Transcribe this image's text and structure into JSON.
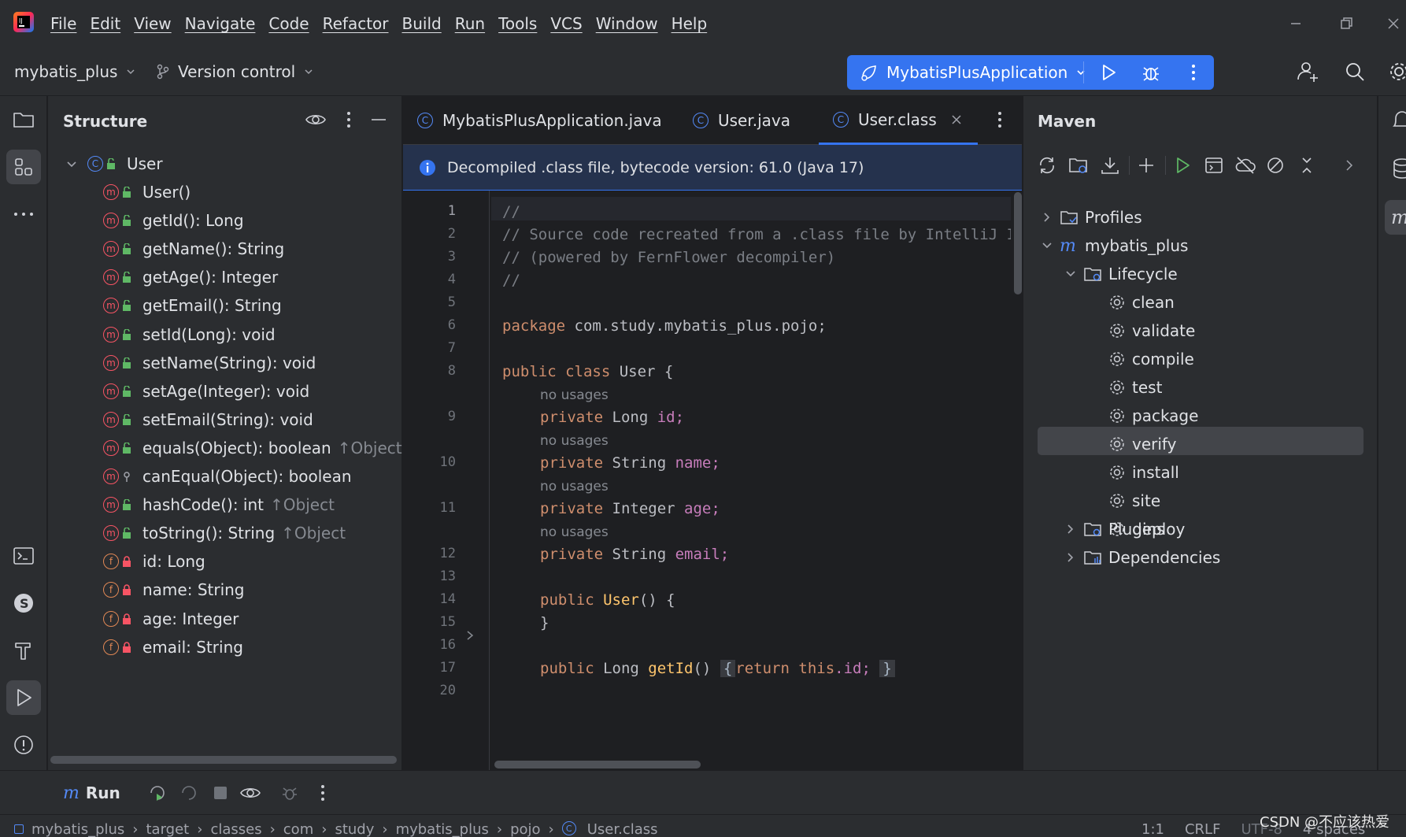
{
  "menu": [
    "File",
    "Edit",
    "View",
    "Navigate",
    "Code",
    "Refactor",
    "Build",
    "Run",
    "Tools",
    "VCS",
    "Window",
    "Help"
  ],
  "toolbar": {
    "project": "mybatis_plus",
    "vcs": "Version control",
    "run_config": "MybatisPlusApplication"
  },
  "structure": {
    "title": "Structure",
    "root": "User",
    "items": [
      {
        "kind": "m",
        "vis": "public",
        "label": "User()",
        "inherit": ""
      },
      {
        "kind": "m",
        "vis": "public",
        "label": "getId(): Long",
        "inherit": ""
      },
      {
        "kind": "m",
        "vis": "public",
        "label": "getName(): String",
        "inherit": ""
      },
      {
        "kind": "m",
        "vis": "public",
        "label": "getAge(): Integer",
        "inherit": ""
      },
      {
        "kind": "m",
        "vis": "public",
        "label": "getEmail(): String",
        "inherit": ""
      },
      {
        "kind": "m",
        "vis": "public",
        "label": "setId(Long): void",
        "inherit": ""
      },
      {
        "kind": "m",
        "vis": "public",
        "label": "setName(String): void",
        "inherit": ""
      },
      {
        "kind": "m",
        "vis": "public",
        "label": "setAge(Integer): void",
        "inherit": ""
      },
      {
        "kind": "m",
        "vis": "public",
        "label": "setEmail(String): void",
        "inherit": ""
      },
      {
        "kind": "m",
        "vis": "public",
        "label": "equals(Object): boolean",
        "inherit": "↑Object"
      },
      {
        "kind": "m",
        "vis": "protected",
        "label": "canEqual(Object): boolean",
        "inherit": ""
      },
      {
        "kind": "m",
        "vis": "public",
        "label": "hashCode(): int",
        "inherit": "↑Object"
      },
      {
        "kind": "m",
        "vis": "public",
        "label": "toString(): String",
        "inherit": "↑Object"
      },
      {
        "kind": "f",
        "vis": "private",
        "label": "id: Long",
        "inherit": ""
      },
      {
        "kind": "f",
        "vis": "private",
        "label": "name: String",
        "inherit": ""
      },
      {
        "kind": "f",
        "vis": "private",
        "label": "age: Integer",
        "inherit": ""
      },
      {
        "kind": "f",
        "vis": "private",
        "label": "email: String",
        "inherit": ""
      }
    ]
  },
  "editor": {
    "tabs": [
      "MybatisPlusApplication.java",
      "User.java",
      "User.class"
    ],
    "active_tab": 2,
    "banner": "Decompiled .class file, bytecode version: 61.0 (Java 17)",
    "line_numbers": [
      "1",
      "2",
      "3",
      "4",
      "5",
      "6",
      "7",
      "8",
      "9",
      "10",
      "11",
      "12",
      "13",
      "14",
      "15",
      "16",
      "17",
      "20"
    ],
    "comment1": "//",
    "comment2": "// Source code recreated from a .class file by IntelliJ IDEA",
    "comment3": "// (powered by FernFlower decompiler)",
    "comment4": "//",
    "kw_package": "package",
    "package_name": " com.study.mybatis_plus.pojo;",
    "kw_public_class": "public class",
    "class_name": " User {",
    "hint": "no usages",
    "kw_private": "private",
    "type_long": " Long ",
    "type_string": " String ",
    "type_integer": " Integer ",
    "field_id": "id;",
    "field_name": "name;",
    "field_age": "age;",
    "field_email": "email;",
    "kw_public": "public",
    "ctor_name": "User",
    "ctor_rest": "() {",
    "close_brace": "}",
    "method_getid": "getId",
    "parens": "()",
    "fold_open": "{",
    "kw_return": "return",
    "kw_this": "this",
    "dot_id": ".id;",
    "fold_close": "}"
  },
  "maven": {
    "title": "Maven",
    "profiles": "Profiles",
    "project": "mybatis_plus",
    "lifecycle": "Lifecycle",
    "goals": [
      "clean",
      "validate",
      "compile",
      "test",
      "package",
      "verify",
      "install",
      "site",
      "deploy"
    ],
    "selected_goal": "compile",
    "plugins": "Plugins",
    "dependencies": "Dependencies"
  },
  "runbar": {
    "label": "Run"
  },
  "status": {
    "crumbs": [
      "mybatis_plus",
      "target",
      "classes",
      "com",
      "study",
      "mybatis_plus",
      "pojo",
      "User.class"
    ],
    "position": "1:1",
    "line_sep": "CRLF",
    "encoding": "UTF-8",
    "indent": "4 spaces"
  },
  "watermark": "CSDN @不应该热爱",
  "colors": {
    "accent": "#3574f0",
    "background": "#1e1f22",
    "panel": "#2b2d30"
  }
}
